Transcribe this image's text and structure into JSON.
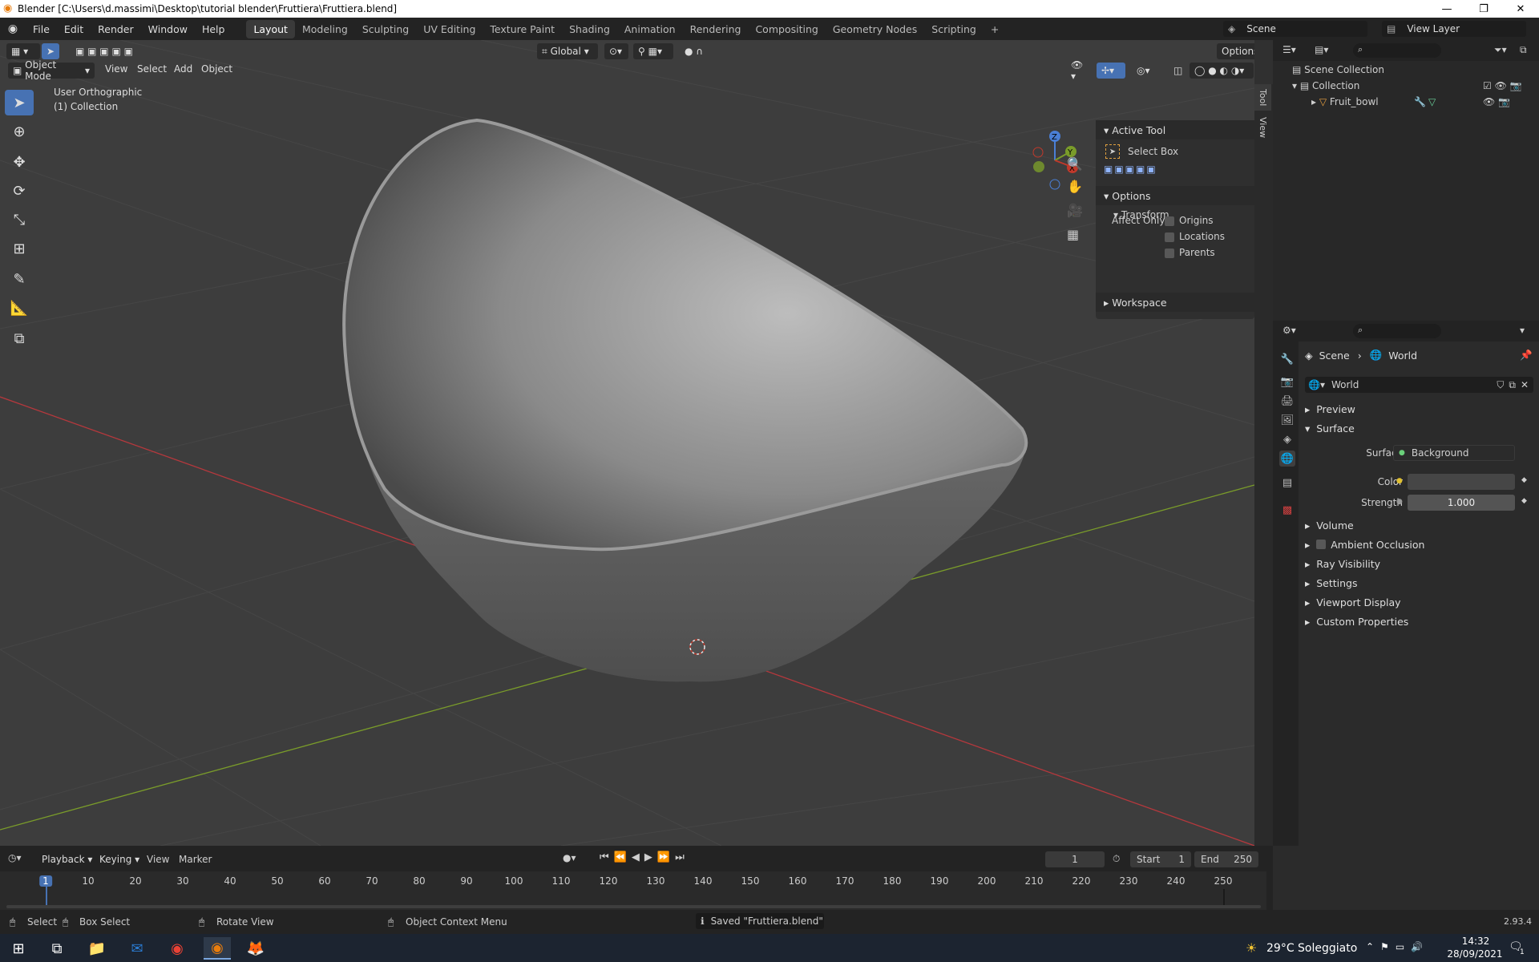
{
  "title_bar": {
    "title": "Blender [C:\\Users\\d.massimi\\Desktop\\tutorial blender\\Fruttiera\\Fruttiera.blend]"
  },
  "top_menu": [
    "File",
    "Edit",
    "Render",
    "Window",
    "Help"
  ],
  "workspaces": [
    "Layout",
    "Modeling",
    "Sculpting",
    "UV Editing",
    "Texture Paint",
    "Shading",
    "Animation",
    "Rendering",
    "Compositing",
    "Geometry Nodes",
    "Scripting"
  ],
  "active_workspace": "Layout",
  "scene_name": "Scene",
  "view_layer": "View Layer",
  "viewport": {
    "mode": "Object Mode",
    "menus": [
      "View",
      "Select",
      "Add",
      "Object"
    ],
    "transform_orientation": "Global",
    "options_label": "Options",
    "view_title": "User Orthographic",
    "view_collection": "(1) Collection"
  },
  "n_panel": {
    "active_tool_header": "Active Tool",
    "tool_name": "Select Box",
    "options_header": "Options",
    "transform_header": "Transform",
    "affect_only_label": "Affect Only",
    "checkboxes": [
      "Origins",
      "Locations",
      "Parents"
    ],
    "workspace_header": "Workspace",
    "tab_tool": "Tool",
    "tab_view": "View"
  },
  "outliner": {
    "root": "Scene Collection",
    "collection": "Collection",
    "object": "Fruit_bowl"
  },
  "properties": {
    "breadcrumb_scene": "Scene",
    "breadcrumb_world": "World",
    "world_name": "World",
    "panels": {
      "preview": "Preview",
      "surface": "Surface",
      "volume": "Volume",
      "ao": "Ambient Occlusion",
      "ray_visibility": "Ray Visibility",
      "settings": "Settings",
      "viewport_display": "Viewport Display",
      "custom_props": "Custom Properties"
    },
    "surface_label": "Surface",
    "surface_value": "Background",
    "color_label": "Color",
    "strength_label": "Strength",
    "strength_value": "1.000"
  },
  "timeline": {
    "menus": [
      "Playback",
      "Keying",
      "View",
      "Marker"
    ],
    "current_frame": "1",
    "start_label": "Start",
    "start_value": "1",
    "end_label": "End",
    "end_value": "250",
    "ticks": [
      "1",
      "10",
      "20",
      "30",
      "40",
      "50",
      "60",
      "70",
      "80",
      "90",
      "100",
      "110",
      "120",
      "130",
      "140",
      "150",
      "160",
      "170",
      "180",
      "190",
      "200",
      "210",
      "220",
      "230",
      "240",
      "250"
    ]
  },
  "status_bar": {
    "select": "Select",
    "box_select": "Box Select",
    "rotate_view": "Rotate View",
    "context_menu": "Object Context Menu",
    "message": "Saved \"Fruttiera.blend\"",
    "version": "2.93.4"
  },
  "taskbar": {
    "weather": "29°C Soleggiato",
    "time": "14:32",
    "date": "28/09/2021",
    "notifications": "1"
  },
  "colors": {
    "accent": "#4772b3",
    "x_axis": "#b5383d",
    "y_axis": "#7a9c2a",
    "bg": "#3d3d3d"
  }
}
